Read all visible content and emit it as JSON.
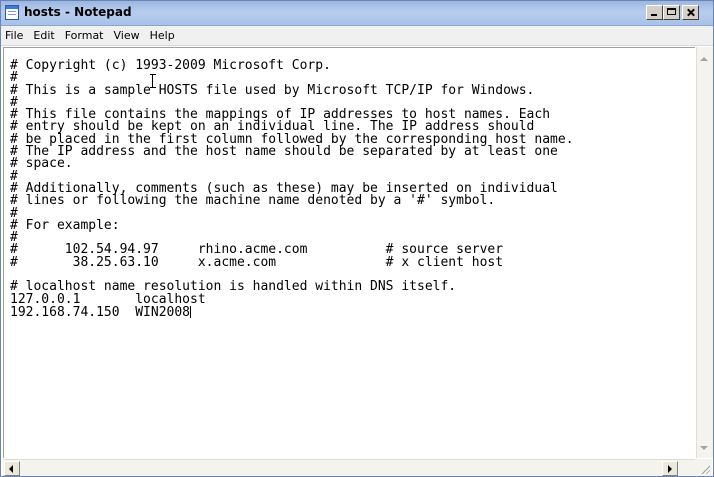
{
  "window": {
    "title": "hosts - Notepad"
  },
  "menu": {
    "items": [
      "File",
      "Edit",
      "Format",
      "View",
      "Help"
    ]
  },
  "editor": {
    "lines": [
      "# Copyright (c) 1993-2009 Microsoft Corp.",
      "#",
      "# This is a sample HOSTS file used by Microsoft TCP/IP for Windows.",
      "#",
      "# This file contains the mappings of IP addresses to host names. Each",
      "# entry should be kept on an individual line. The IP address should",
      "# be placed in the first column followed by the corresponding host name.",
      "# The IP address and the host name should be separated by at least one",
      "# space.",
      "#",
      "# Additionally, comments (such as these) may be inserted on individual",
      "# lines or following the machine name denoted by a '#' symbol.",
      "#",
      "# For example:",
      "#",
      "#      102.54.94.97     rhino.acme.com          # source server",
      "#       38.25.63.10     x.acme.com              # x client host",
      "",
      "# localhost name resolution is handled within DNS itself.",
      "127.0.0.1       localhost",
      "192.168.74.150  WIN2008"
    ]
  },
  "icons": {
    "app": "notepad-icon",
    "minimize": "minimize-icon",
    "maximize": "maximize-icon",
    "close": "close-icon"
  }
}
